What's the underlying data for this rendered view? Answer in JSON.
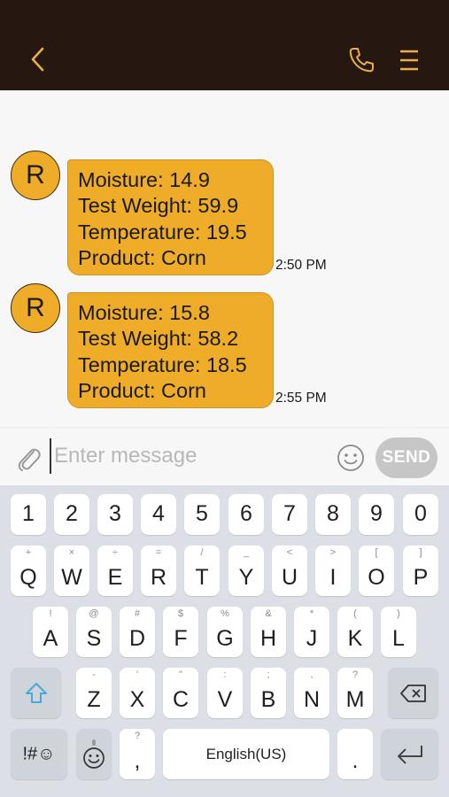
{
  "header": {
    "back_icon": "chevron-left-icon",
    "call_icon": "phone-icon",
    "menu_icon": "menu-icon",
    "accent_color": "#e8b04c",
    "background_color": "#261710"
  },
  "messages": [
    {
      "avatar_letter": "R",
      "lines": [
        "Moisture: 14.9",
        "Test Weight: 59.9",
        "Temperature: 19.5",
        "Product: Corn"
      ],
      "time": "2:50 PM"
    },
    {
      "avatar_letter": "R",
      "lines": [
        "Moisture: 15.8",
        "Test Weight: 58.2",
        "Temperature: 18.5",
        "Product: Corn"
      ],
      "time": "2:55 PM"
    }
  ],
  "composer": {
    "attach_icon": "paperclip-icon",
    "placeholder": "Enter message",
    "emoji_icon": "smiley-icon",
    "send_label": "SEND"
  },
  "keyboard": {
    "numbers": [
      "1",
      "2",
      "3",
      "4",
      "5",
      "6",
      "7",
      "8",
      "9",
      "0"
    ],
    "row1": [
      "Q",
      "W",
      "E",
      "R",
      "T",
      "Y",
      "U",
      "I",
      "O",
      "P"
    ],
    "row1_sub": [
      "+",
      "×",
      "÷",
      "=",
      "/",
      "_",
      "<",
      ">",
      "[",
      "]"
    ],
    "row2": [
      "A",
      "S",
      "D",
      "F",
      "G",
      "H",
      "J",
      "K",
      "L"
    ],
    "row2_sub": [
      "!",
      "@",
      "#",
      "$",
      "%",
      "&",
      "*",
      "(",
      ")"
    ],
    "row3": [
      "Z",
      "X",
      "C",
      "V",
      "B",
      "N",
      "M"
    ],
    "row3_sub": [
      "-",
      "'",
      "\"",
      ":",
      ";",
      ",",
      "?"
    ],
    "symbols_label": "!#☺",
    "comma_label": ",",
    "comma_sub": "?",
    "space_label": "English(US)",
    "period_label": ".",
    "shift_icon": "shift-arrow-icon",
    "backspace_icon": "backspace-icon",
    "emoji_key_icon": "emoji-key-icon",
    "enter_icon": "enter-arrow-icon",
    "shift_color": "#4aa8d8"
  }
}
